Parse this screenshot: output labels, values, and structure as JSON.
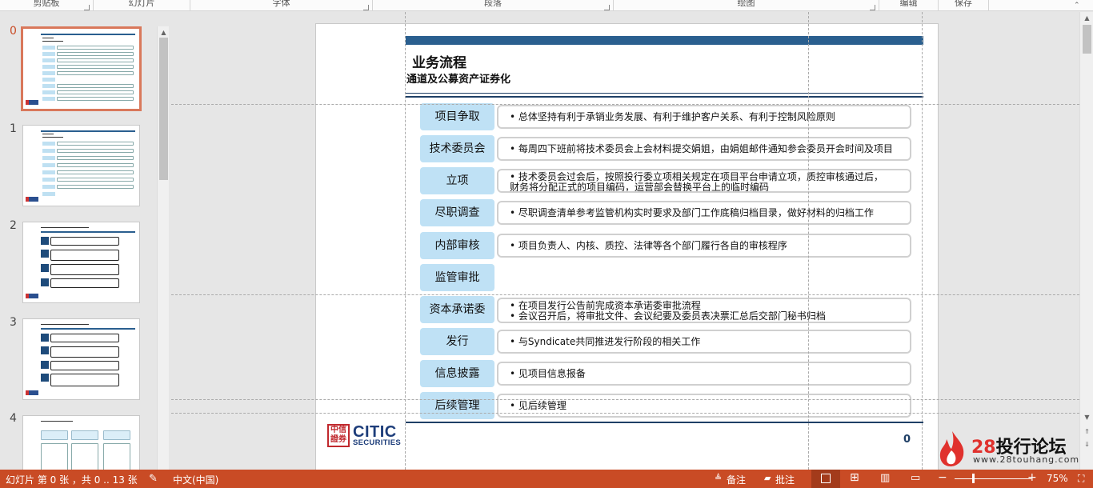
{
  "ribbon": {
    "groups": [
      "剪贴板",
      "幻灯片",
      "字体",
      "段落",
      "绘图",
      "编辑",
      "保存"
    ]
  },
  "thumbnails": [
    {
      "number": "0"
    },
    {
      "number": "1"
    },
    {
      "number": "2"
    },
    {
      "number": "3"
    },
    {
      "number": "4"
    }
  ],
  "slide": {
    "title": "业务流程",
    "subtitle": "通道及公募资产证券化",
    "page_number": "0",
    "logo": {
      "name": "CITIC",
      "sub": "SECURITIES",
      "seal": "中信證券"
    },
    "rows": [
      {
        "label": "项目争取",
        "lines": [
          "• 总体坚持有利于承销业务发展、有利于维护客户关系、有利于控制风险原则"
        ]
      },
      {
        "label": "技术委员会",
        "lines": [
          "• 每周四下班前将技术委员会上会材料提交娟姐，由娟姐邮件通知参会委员开会时间及项目"
        ]
      },
      {
        "label": "立项",
        "lines": [
          "• 技术委员会过会后，按照投行委立项相关规定在项目平台申请立项，质控审核通过后，",
          "   财务将分配正式的项目编码，运营部会替换平台上的临时编码"
        ]
      },
      {
        "label": "尽职调查",
        "lines": [
          "• 尽职调查清单参考监管机构实时要求及部门工作底稿归档目录，做好材料的归档工作"
        ]
      },
      {
        "label": "内部审核",
        "lines": [
          "• 项目负责人、内核、质控、法律等各个部门履行各自的审核程序"
        ]
      },
      {
        "label": "监管审批",
        "lines": []
      },
      {
        "label": "资本承诺委",
        "lines": [
          "• 在项目发行公告前完成资本承诺委审批流程",
          "• 会议召开后，将审批文件、会议纪要及委员表决票汇总后交部门秘书归档"
        ]
      },
      {
        "label": "发行",
        "lines": [
          "• 与Syndicate共同推进发行阶段的相关工作"
        ]
      },
      {
        "label": "信息披露",
        "lines": [
          "• 见项目信息报备"
        ]
      },
      {
        "label": "后续管理",
        "lines": [
          "• 见后续管理"
        ]
      }
    ]
  },
  "watermark": {
    "number": "28",
    "title": "投行论坛",
    "url": "www.28touhang.com"
  },
  "status": {
    "slide_info": "幻灯片 第 0 张 ，共 0 .. 13 张",
    "language": "中文(中国)",
    "notes": "备注",
    "comments": "批注",
    "zoom": "75%"
  },
  "colors": {
    "status_bar": "#c94b25",
    "accent_blue": "#2a5f8f",
    "pill": "#bfe1f5",
    "selection": "#d9785b"
  }
}
